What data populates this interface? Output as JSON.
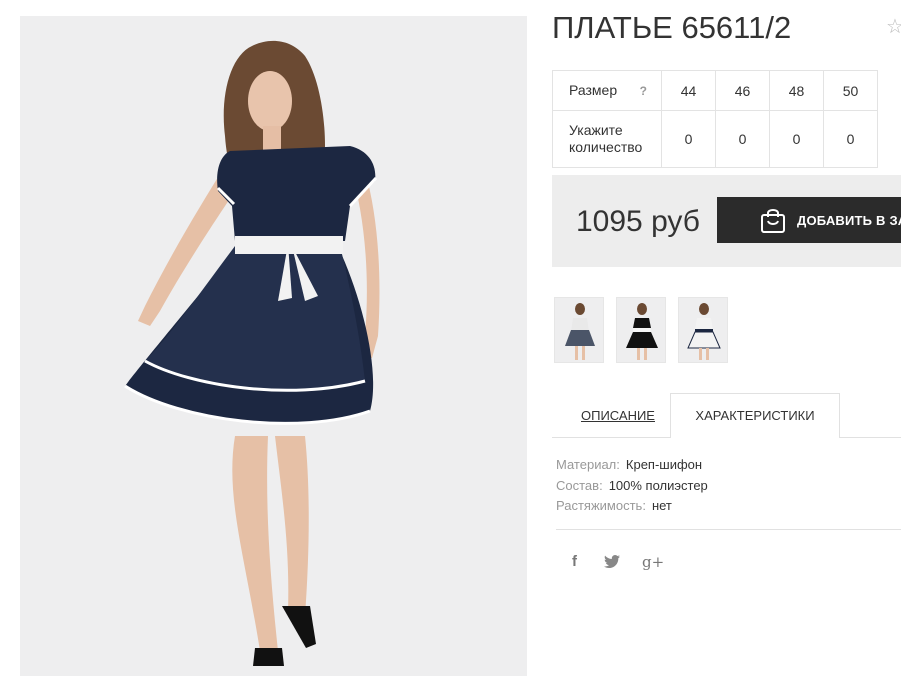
{
  "product": {
    "title": "ПЛАТЬЕ 65611/2",
    "favorite_icon": "star-outline-icon"
  },
  "size_table": {
    "size_label": "Размер",
    "help_mark": "?",
    "sizes": [
      "44",
      "46",
      "48",
      "50"
    ],
    "quantity_label_line1": "Укажите",
    "quantity_label_line2": "количество",
    "quantities": [
      "0",
      "0",
      "0",
      "0"
    ]
  },
  "buy": {
    "price": "1095 руб",
    "add_to_cart_label": "ДОБАВИТЬ В ЗАК",
    "cart_icon": "shopping-bag-icon"
  },
  "thumbnails": [
    {
      "alt": "dress-photo-1"
    },
    {
      "alt": "dress-photo-2"
    },
    {
      "alt": "dress-photo-3"
    }
  ],
  "tabs": [
    {
      "label": "ОПИСАНИЕ",
      "active": false
    },
    {
      "label": "ХАРАКТЕРИСТИКИ",
      "active": true
    }
  ],
  "specs": [
    {
      "key": "Материал:",
      "value": "Креп-шифон"
    },
    {
      "key": "Состав:",
      "value": "100% полиэстер"
    },
    {
      "key": "Растяжимость:",
      "value": "нет"
    }
  ],
  "social": {
    "facebook": "f",
    "twitter": "twitter-bird-icon",
    "google_plus": "g+"
  },
  "colors": {
    "dress_navy": "#1c2741",
    "button_dark": "#2b2b2b",
    "buy_box_bg": "#ededed",
    "photo_bg": "#eeeeef"
  }
}
